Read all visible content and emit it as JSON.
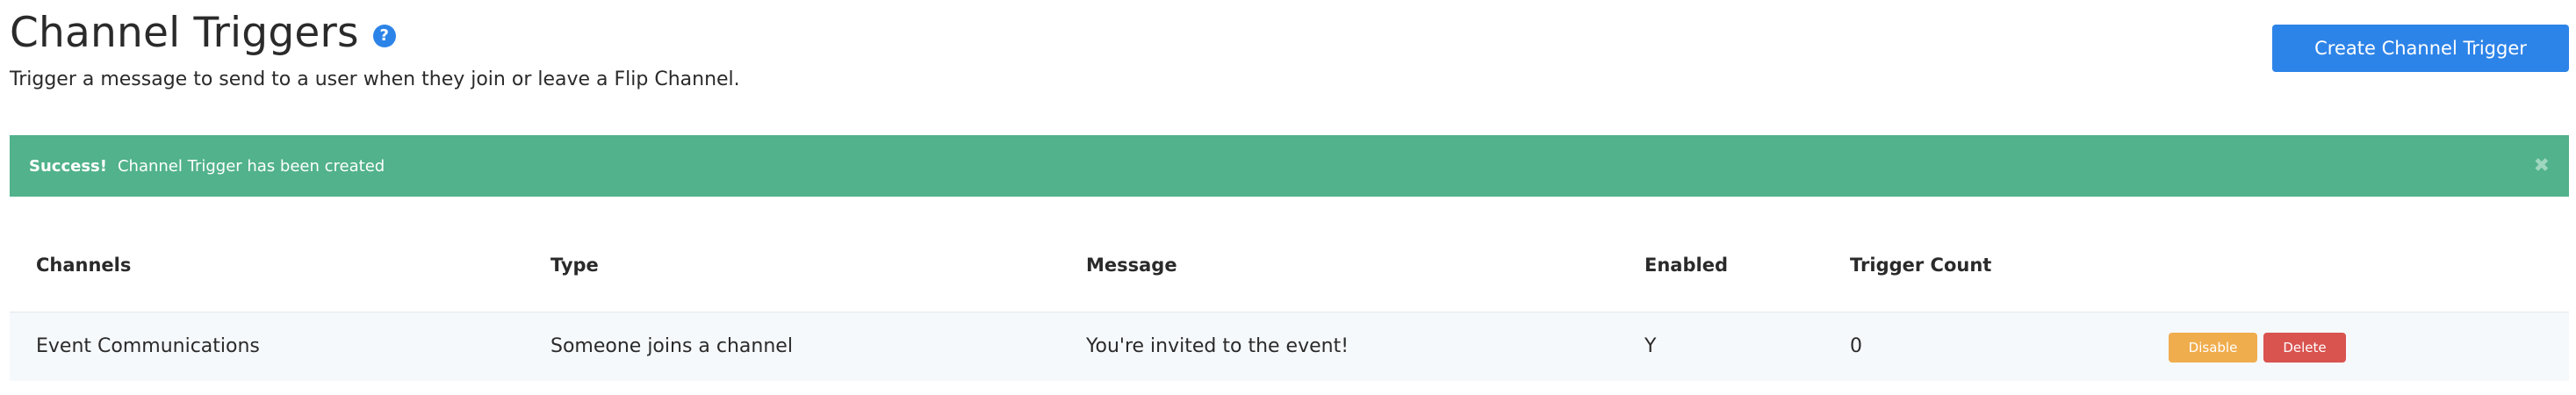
{
  "header": {
    "title": "Channel Triggers",
    "help_icon": "?",
    "subtitle": "Trigger a message to send to a user when they join or leave a Flip Channel.",
    "create_button": "Create Channel Trigger"
  },
  "alert": {
    "strong": "Success!",
    "message": "Channel Trigger has been created",
    "close": "✖",
    "color": "#51b28b"
  },
  "table": {
    "columns": [
      "Channels",
      "Type",
      "Message",
      "Enabled",
      "Trigger Count"
    ],
    "rows": [
      {
        "channels": "Event Communications",
        "type": "Someone joins a channel",
        "message": "You're invited to the event!",
        "enabled": "Y",
        "trigger_count": "0",
        "disable_label": "Disable",
        "delete_label": "Delete"
      }
    ]
  },
  "colors": {
    "primary": "#2d84e8",
    "warning": "#f0ad4e",
    "danger": "#d9534f"
  }
}
